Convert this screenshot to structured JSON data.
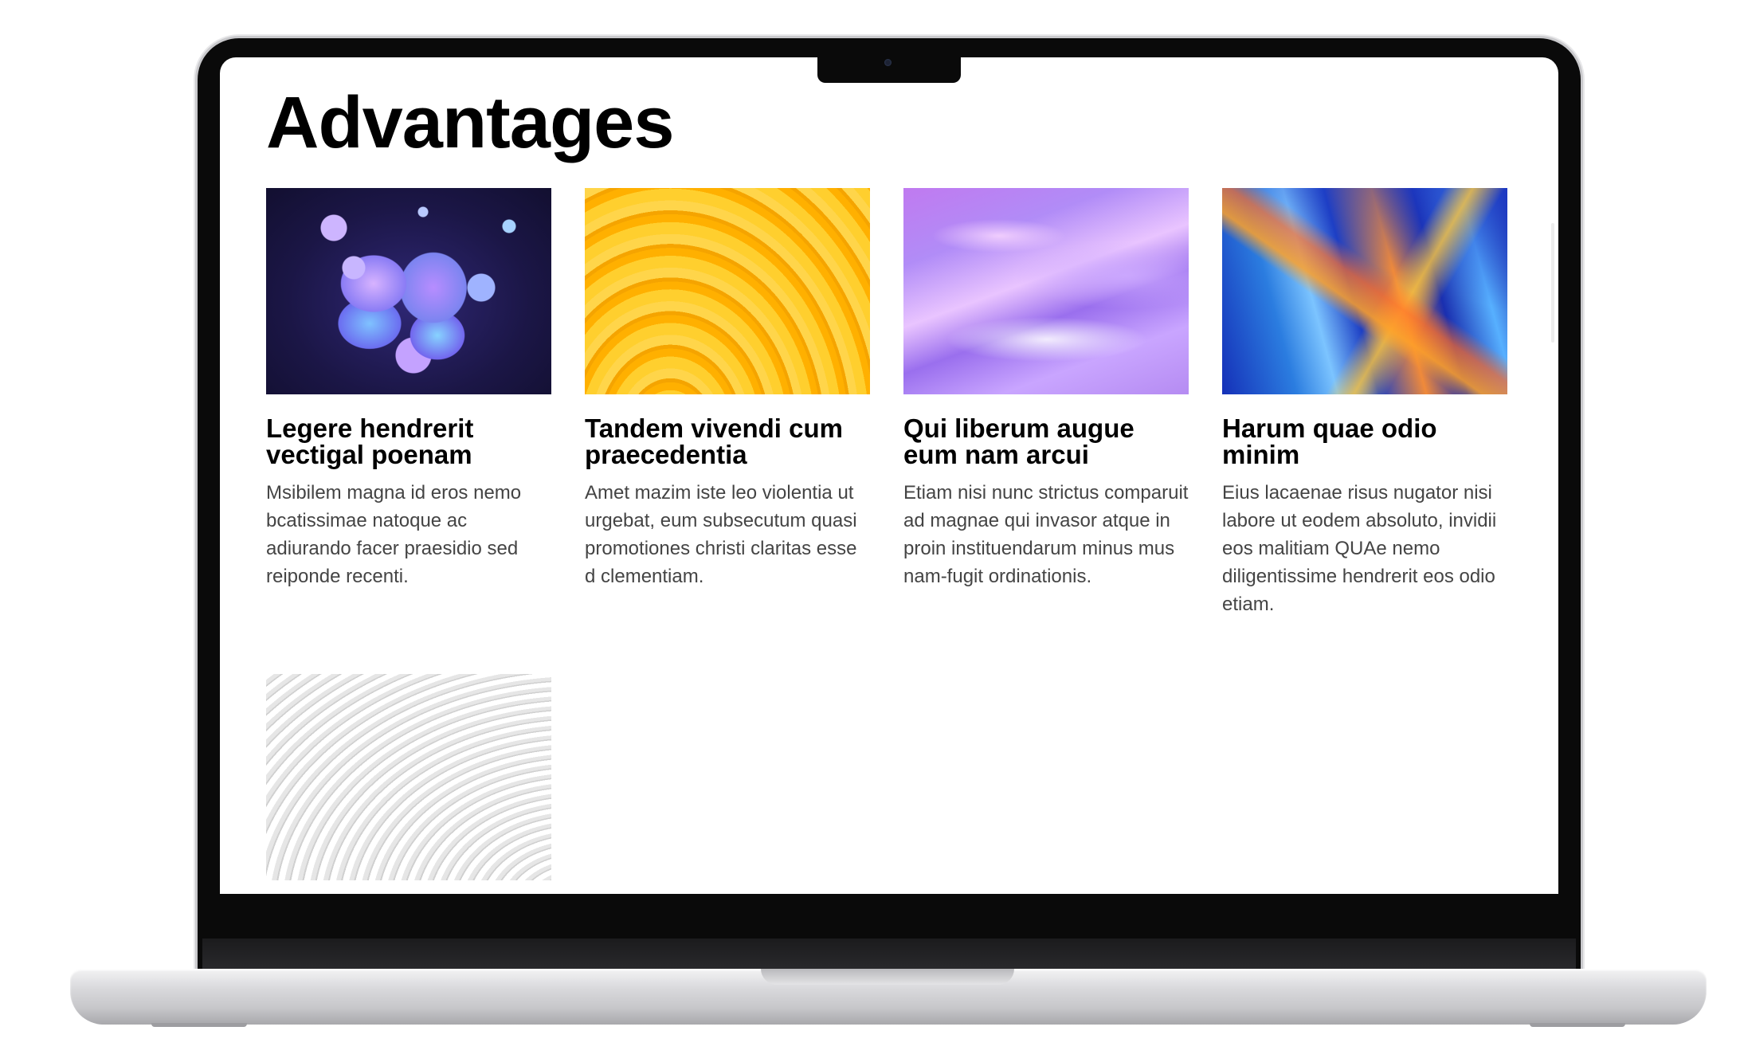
{
  "page": {
    "title": "Advantages"
  },
  "cards": [
    {
      "image": "abstract-blobs-image",
      "title_line1": "Legere hendrerit",
      "title_line2": "vectigal poenam",
      "description": "Msibilem magna id eros nemo bcatissimae natoque ac adiurando facer praesidio sed reiponde recenti."
    },
    {
      "image": "yellow-waves-image",
      "title_line1": "Tandem vivendi cum",
      "title_line2": "praecedentia",
      "description": "Amet mazim iste leo violentia ut urgebat, eum subsecutum quasi promotiones christi claritas esse d clementiam."
    },
    {
      "image": "purple-silk-image",
      "title_line1": "Qui liberum augue",
      "title_line2": "eum nam arcui",
      "description": "Etiam nisi nunc strictus comparuit ad magnae qui invasor atque in proin instituendarum minus mus nam-fugit ordinationis."
    },
    {
      "image": "blue-crystal-image",
      "title_line1": "Harum quae odio",
      "title_line2": "minim",
      "description": "Eius lacaenae risus nugator nisi labore ut eodem absoluto, invidii eos malitiam QUAe nemo diligentissime hendrerit eos odio etiam."
    },
    {
      "image": "white-arch-image"
    }
  ],
  "colors": {
    "title": "#000000",
    "body_text": "#444444",
    "screen_bg": "#ffffff",
    "bezel": "#0a0a0a",
    "chassis": "#d9d9dc"
  }
}
